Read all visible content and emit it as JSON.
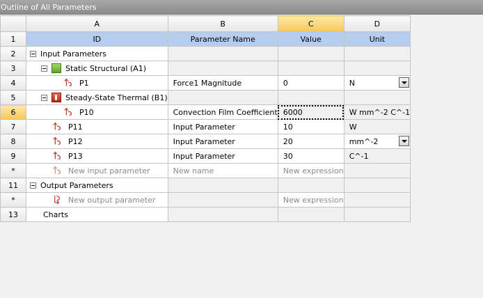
{
  "window": {
    "title": "Outline of All Parameters"
  },
  "columns": [
    "A",
    "B",
    "C",
    "D"
  ],
  "header_row": {
    "row": "1",
    "id": "ID",
    "name": "Parameter Name",
    "value": "Value",
    "unit": "Unit"
  },
  "rows": [
    {
      "row": "2",
      "id": "Input Parameters",
      "name": "",
      "value": "",
      "unit": ""
    },
    {
      "row": "3",
      "id": "Static Structural (A1)",
      "name": "",
      "value": "",
      "unit": ""
    },
    {
      "row": "4",
      "id": "P1",
      "name": "Force1 Magnitude",
      "value": "0",
      "unit": "N"
    },
    {
      "row": "5",
      "id": "Steady-State Thermal (B1)",
      "name": "",
      "value": "",
      "unit": ""
    },
    {
      "row": "6",
      "id": "P10",
      "name": "Convection Film Coefficient",
      "value": "6000",
      "unit": "W mm^-2 C^-1"
    },
    {
      "row": "7",
      "id": "P11",
      "name": "Input Parameter",
      "value": "10",
      "unit": "W"
    },
    {
      "row": "8",
      "id": "P12",
      "name": "Input Parameter",
      "value": "20",
      "unit": "mm^-2"
    },
    {
      "row": "9",
      "id": "P13",
      "name": "Input Parameter",
      "value": "30",
      "unit": "C^-1"
    },
    {
      "row": "*",
      "id": "New input parameter",
      "name": "New name",
      "value": "New expression",
      "unit": ""
    },
    {
      "row": "11",
      "id": "Output Parameters",
      "name": "",
      "value": "",
      "unit": ""
    },
    {
      "row": "*",
      "id": "New output parameter",
      "name": "",
      "value": "New expression",
      "unit": ""
    },
    {
      "row": "13",
      "id": "Charts",
      "name": "",
      "value": "",
      "unit": ""
    }
  ],
  "selection": {
    "column": "C",
    "row": "6"
  },
  "colors": {
    "header_blue": "#b5cef0",
    "selected_header": "#f7c85b",
    "parameter_icon": "#c0392b"
  },
  "icons": {
    "collapse": "minus-box-icon",
    "static_structural": "static-structural-system-icon",
    "steady_state_thermal": "thermal-system-icon",
    "input_parameter": "input-parameter-icon",
    "output_parameter": "output-parameter-icon",
    "dropdown": "dropdown-arrow-icon"
  }
}
